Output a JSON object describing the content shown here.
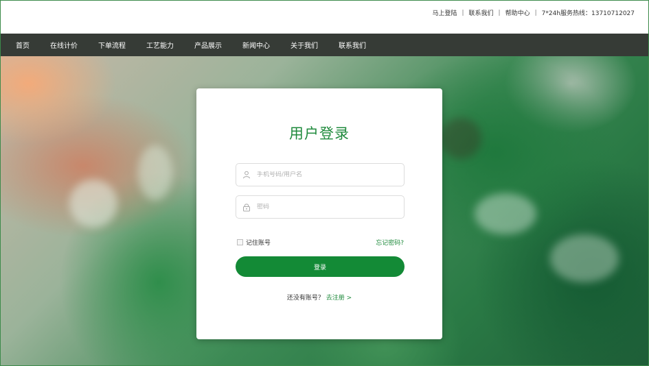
{
  "topbar": {
    "links": [
      "马上登陆",
      "联系我们",
      "帮助中心"
    ],
    "hotline": "7*24h服务热线：13710712027",
    "separator": "|"
  },
  "nav": {
    "items": [
      "首页",
      "在线计价",
      "下单流程",
      "工艺能力",
      "产品展示",
      "新闻中心",
      "关于我们",
      "联系我们"
    ]
  },
  "login": {
    "title": "用户登录",
    "username_placeholder": "手机号码/用户名",
    "password_placeholder": "密码",
    "remember_label": "记住账号",
    "forgot_label": "忘记密码?",
    "submit_label": "登录",
    "no_account_text": "还没有账号？",
    "register_label": "去注册 >"
  },
  "colors": {
    "brand_green": "#1f8a3c",
    "button_green": "#138a36",
    "nav_bg": "#363b36"
  },
  "icons": {
    "username": "user-icon",
    "password": "lock-icon"
  }
}
